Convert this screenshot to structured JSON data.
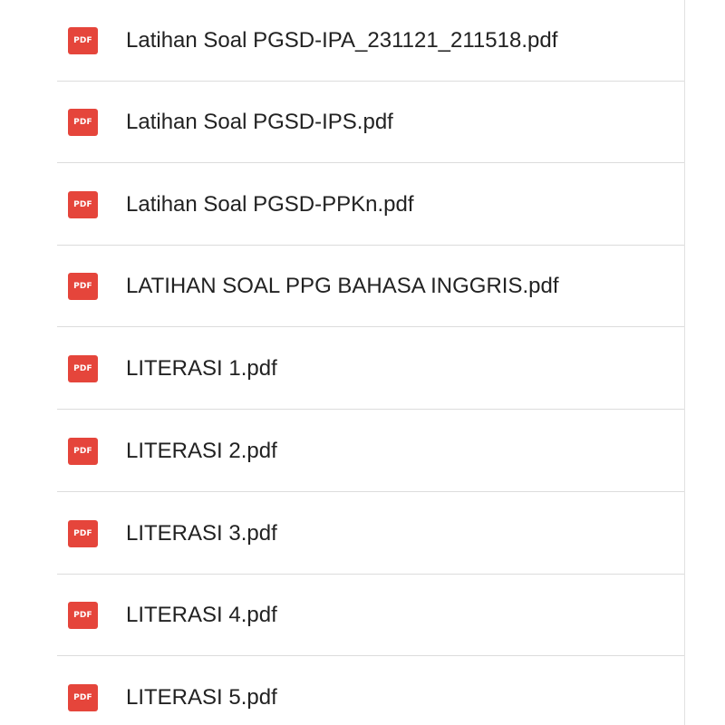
{
  "files": [
    {
      "name": "Latihan Soal PGSD-IPA_231121_211518.pdf",
      "icon": "pdf-file-icon",
      "icon_label": "PDF"
    },
    {
      "name": "Latihan Soal PGSD-IPS.pdf",
      "icon": "pdf-file-icon",
      "icon_label": "PDF"
    },
    {
      "name": "Latihan Soal PGSD-PPKn.pdf",
      "icon": "pdf-file-icon",
      "icon_label": "PDF"
    },
    {
      "name": "LATIHAN SOAL PPG BAHASA INGGRIS.pdf",
      "icon": "pdf-file-icon",
      "icon_label": "PDF"
    },
    {
      "name": "LITERASI 1.pdf",
      "icon": "pdf-file-icon",
      "icon_label": "PDF"
    },
    {
      "name": "LITERASI 2.pdf",
      "icon": "pdf-file-icon",
      "icon_label": "PDF"
    },
    {
      "name": "LITERASI 3.pdf",
      "icon": "pdf-file-icon",
      "icon_label": "PDF"
    },
    {
      "name": "LITERASI 4.pdf",
      "icon": "pdf-file-icon",
      "icon_label": "PDF"
    },
    {
      "name": "LITERASI 5.pdf",
      "icon": "pdf-file-icon",
      "icon_label": "PDF"
    }
  ],
  "colors": {
    "pdf_icon": "#e5453b",
    "divider": "#dcdcdc",
    "text": "#222222"
  }
}
